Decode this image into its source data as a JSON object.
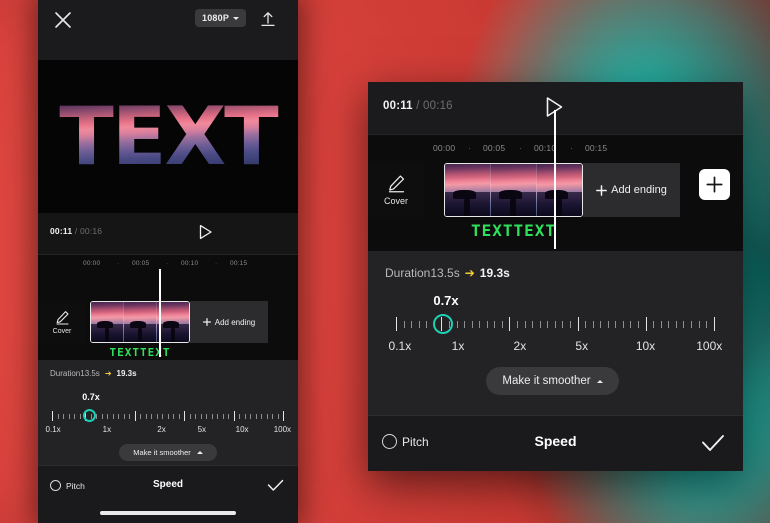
{
  "background": {
    "accent_red": "#e2443d",
    "accent_teal": "#05b5ab",
    "accent_dark_teal": "#04332f"
  },
  "phone": {
    "topbar": {
      "close_icon": "close-icon",
      "resolution": "1080P",
      "upload_icon": "upload-icon"
    },
    "preview": {
      "masked_text": "TEXT"
    }
  },
  "editor": {
    "player": {
      "current_time": "00:11",
      "separator": "/",
      "total_time": "00:16",
      "play_icon": "play-icon"
    },
    "ruler": {
      "labels": [
        "00:00",
        "00:05",
        "00:10",
        "00:15"
      ],
      "dot": "·"
    },
    "timeline": {
      "cover_label": "Cover",
      "cover_icon": "pencil-icon",
      "add_ending_label": "Add ending",
      "add_ending_icon": "plus-icon",
      "add_button_icon": "plus-icon",
      "overlay_text": "TEXTTEXT"
    },
    "speed": {
      "duration_label": "Duration13.5s",
      "duration_arrow": "➔",
      "duration_new": "19.3s",
      "current_speed": "0.7x",
      "scale_labels": [
        "0.1x",
        "1x",
        "2x",
        "5x",
        "10x",
        "100x"
      ],
      "scale_positions": [
        5,
        26,
        47,
        62,
        78,
        95
      ],
      "thumb_color": "#1ecfb4",
      "smoother_label": "Make it smoother",
      "smoother_caret": "caret-up-icon"
    },
    "bottom": {
      "pitch_label": "Pitch",
      "pitch_toggle_icon": "circle-toggle-icon",
      "title": "Speed",
      "confirm_icon": "checkmark-icon"
    }
  }
}
